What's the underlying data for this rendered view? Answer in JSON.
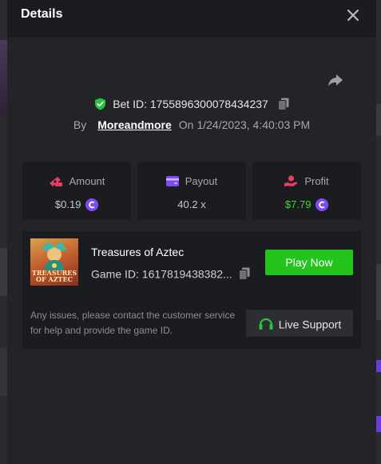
{
  "modal": {
    "title": "Details",
    "icons": {
      "close": "close-icon",
      "share": "share-icon",
      "verified": "shield-check-icon",
      "copy": "copy-icon"
    }
  },
  "bet": {
    "id_label": "Bet ID: 1755896300078434237",
    "by_label": "By",
    "username": "Moreandmore",
    "on_label": "On",
    "datetime": "1/24/2023, 4:40:03 PM"
  },
  "stats": [
    {
      "label": "Amount",
      "value": "$0.19",
      "icon": "money-icon",
      "icon_color": "#e53d62"
    },
    {
      "label": "Payout",
      "value": "40.2 x",
      "icon": "wallet-icon",
      "icon_color": "#7b4cf6"
    },
    {
      "label": "Profit",
      "value": "$7.79",
      "icon": "hand-coin-icon",
      "icon_color": "#e53d62",
      "value_color": "#40d43e"
    }
  ],
  "game": {
    "name": "Treasures of Aztec",
    "thumb_text_line1": "TREASURES",
    "thumb_text_line2": "OF AZTEC",
    "id_label": "Game ID: 1617819438382...",
    "play_label": "Play Now",
    "support_text": "Any issues, please contact the customer service for help and provide the game ID.",
    "live_support_label": "Live Support"
  },
  "colors": {
    "accent_green": "#24c41f",
    "coin_purple": "#7b4cf6",
    "icon_red": "#e53d62"
  }
}
